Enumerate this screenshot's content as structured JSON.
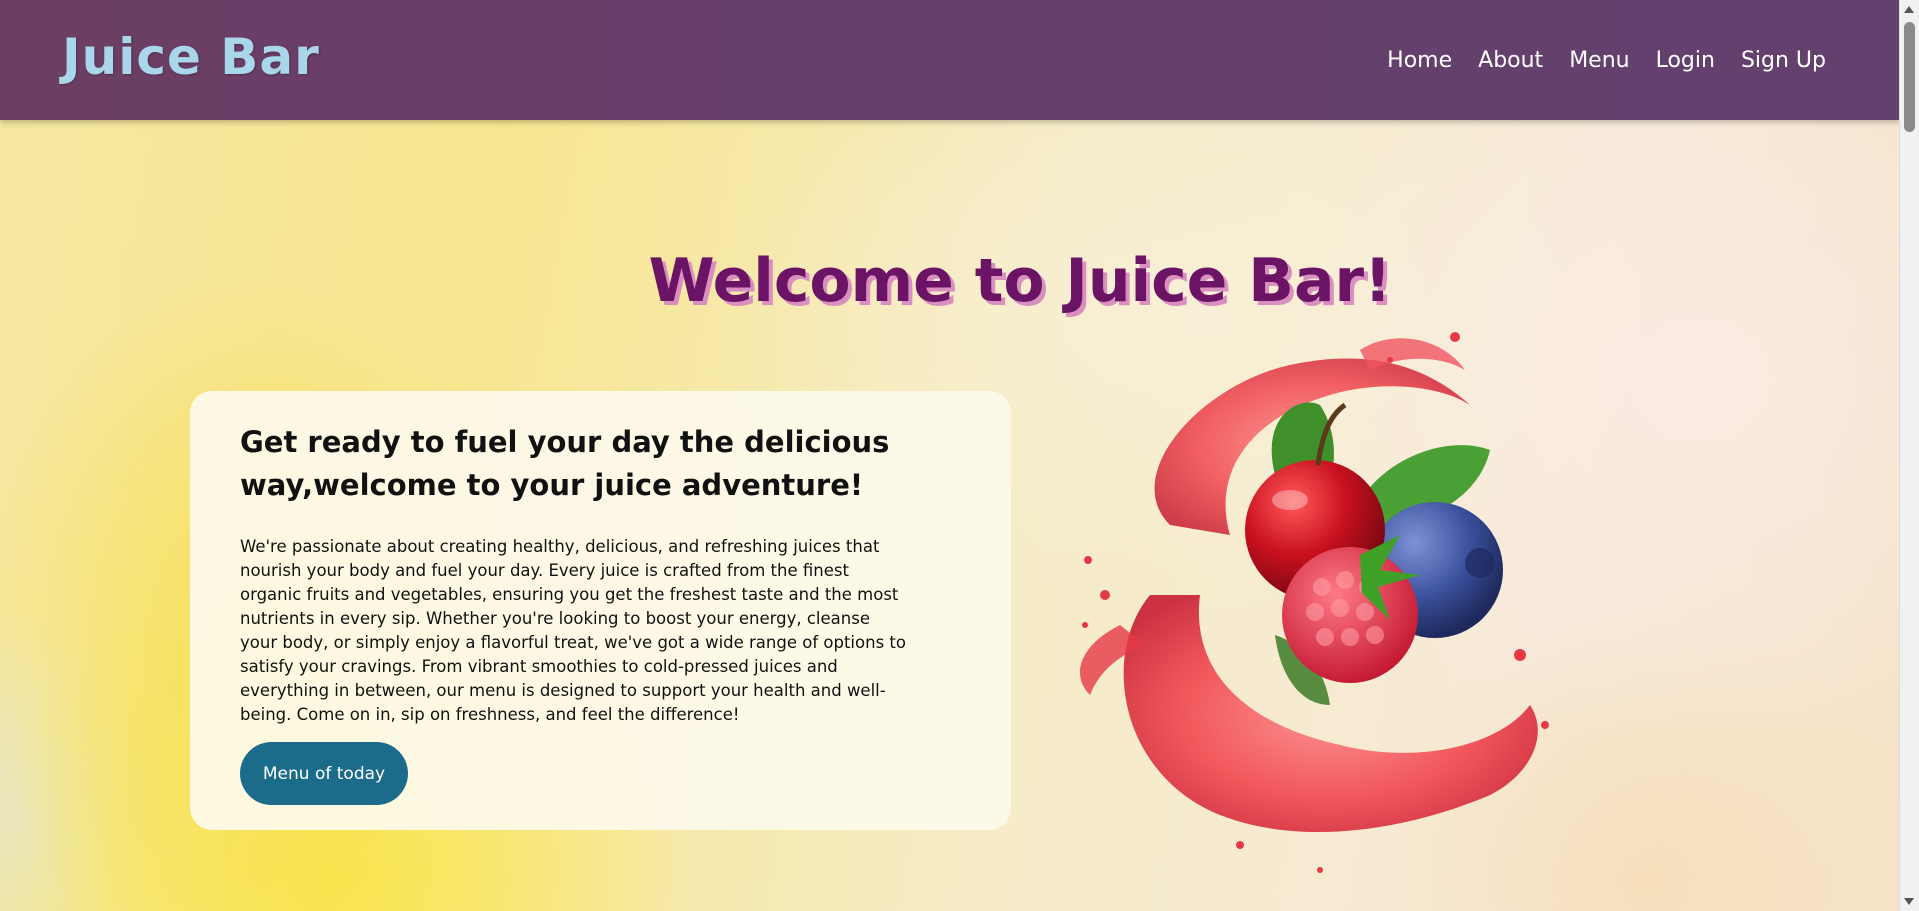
{
  "header": {
    "logo": "Juice Bar",
    "nav": [
      {
        "label": "Home"
      },
      {
        "label": "About"
      },
      {
        "label": "Menu"
      },
      {
        "label": "Login"
      },
      {
        "label": "Sign Up"
      }
    ]
  },
  "hero": {
    "title": "Welcome to Juice Bar!"
  },
  "intro_card": {
    "heading": "Get ready to fuel your day the delicious way,welcome to your juice adventure!",
    "body": "We're passionate about creating healthy, delicious, and refreshing juices that nourish your body and fuel your day. Every juice is crafted from the finest organic fruits and vegetables, ensuring you get the freshest taste and the most nutrients in every sip. Whether you're looking to boost your energy, cleanse your body, or simply enjoy a flavorful treat, we've got a wide range of options to satisfy your cravings. From vibrant smoothies to cold-pressed juices and everything in between, our menu is designed to support your health and well-being. Come on in, sip on freshness, and feel the difference!",
    "button_label": "Menu of today"
  },
  "colors": {
    "header_bg": "#663f6c",
    "logo": "#a9d6ea",
    "title": "#6b1466",
    "title_shadow": "#d98fc0",
    "button": "#1b6b8b"
  },
  "illustration": {
    "icon": "fruit-splash-icon"
  }
}
